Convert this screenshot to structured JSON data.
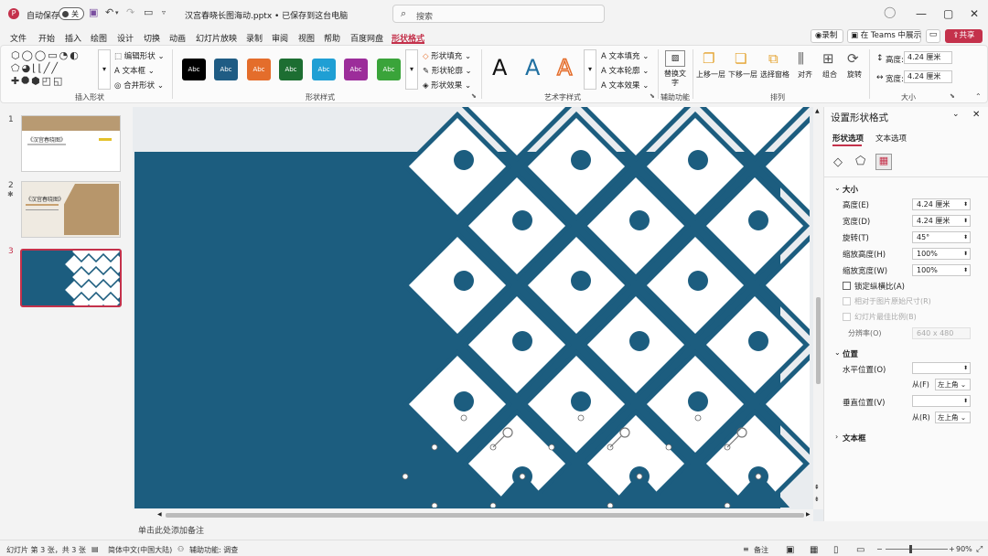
{
  "titlebar": {
    "autosave_label": "自动保存",
    "autosave_state": "关",
    "filename": "汉宫春晓长图海动.pptx • 已保存到这台电脑",
    "search_placeholder": "搜索",
    "avatar_glyph": "◯"
  },
  "menu": {
    "items": [
      "文件",
      "开始",
      "插入",
      "绘图",
      "设计",
      "切换",
      "动画",
      "幻灯片放映",
      "录制",
      "审阅",
      "视图",
      "帮助",
      "百度网盘",
      "形状格式"
    ],
    "active_index": 13,
    "record_label": "录制",
    "teams_label": "在 Teams 中展示",
    "share_label": "共享"
  },
  "ribbon": {
    "insert_shapes": {
      "edit_shape": "编辑形状",
      "textbox": "文本框",
      "merge_shapes": "合并形状",
      "group_label": "插入形状"
    },
    "shape_styles": {
      "swatch_text": "Abc",
      "swatches": [
        "#000000",
        "#1f5c84",
        "#e46d2b",
        "#1d6e32",
        "#1f9fd4",
        "#9c2d9a",
        "#3aa43a"
      ],
      "fill": "形状填充",
      "outline": "形状轮廓",
      "effects": "形状效果",
      "group_label": "形状样式"
    },
    "wordart": {
      "letter": "A",
      "text_fill": "文本填充",
      "text_outline": "文本轮廓",
      "text_effects": "文本效果",
      "group_label": "艺术字样式"
    },
    "accessibility": {
      "alt_text": "替换文字",
      "group_label": "辅助功能"
    },
    "arrange": {
      "bring_forward": "上移一层",
      "send_backward": "下移一层",
      "selection_pane": "选择窗格",
      "align": "对齐",
      "group": "组合",
      "rotate": "旋转",
      "group_label": "排列"
    },
    "size": {
      "height_label": "高度:",
      "height_value": "4.24 厘米",
      "width_label": "宽度:",
      "width_value": "4.24 厘米",
      "group_label": "大小"
    }
  },
  "thumbnails": [
    {
      "number": "1",
      "caption": "《汉宫春晓图》"
    },
    {
      "number": "2",
      "caption": "《汉宫春晓图》"
    },
    {
      "number": "3",
      "caption": ""
    }
  ],
  "pane": {
    "title": "设置形状格式",
    "tabs": [
      "形状选项",
      "文本选项"
    ],
    "size_section": "大小",
    "height_label": "高度(E)",
    "height_value": "4.24 厘米",
    "width_label": "宽度(D)",
    "width_value": "4.24 厘米",
    "rotation_label": "旋转(T)",
    "rotation_value": "45°",
    "scale_h_label": "缩放高度(H)",
    "scale_h_value": "100%",
    "scale_w_label": "缩放宽度(W)",
    "scale_w_value": "100%",
    "lock_ratio": "锁定纵横比(A)",
    "relative_original": "相对于图片原始尺寸(R)",
    "best_scale": "幻灯片最佳比例(B)",
    "resolution_label": "分辨率(O)",
    "resolution_value": "640 x 480",
    "position_section": "位置",
    "h_pos_label": "水平位置(O)",
    "from_label_1": "从(F)",
    "from_value_1": "左上角",
    "v_pos_label": "垂直位置(V)",
    "from_label_2": "从(R)",
    "from_value_2": "左上角",
    "textbox_section": "文本框"
  },
  "notes_placeholder": "单击此处添加备注",
  "status": {
    "slide_info": "幻灯片 第 3 张，共 3 张",
    "language": "简体中文(中国大陆)",
    "accessibility": "辅助功能: 调查",
    "notes": "备注",
    "zoom": "90%"
  },
  "colors": {
    "accent": "#c4314b",
    "slide_bg": "#1c5d7f"
  }
}
